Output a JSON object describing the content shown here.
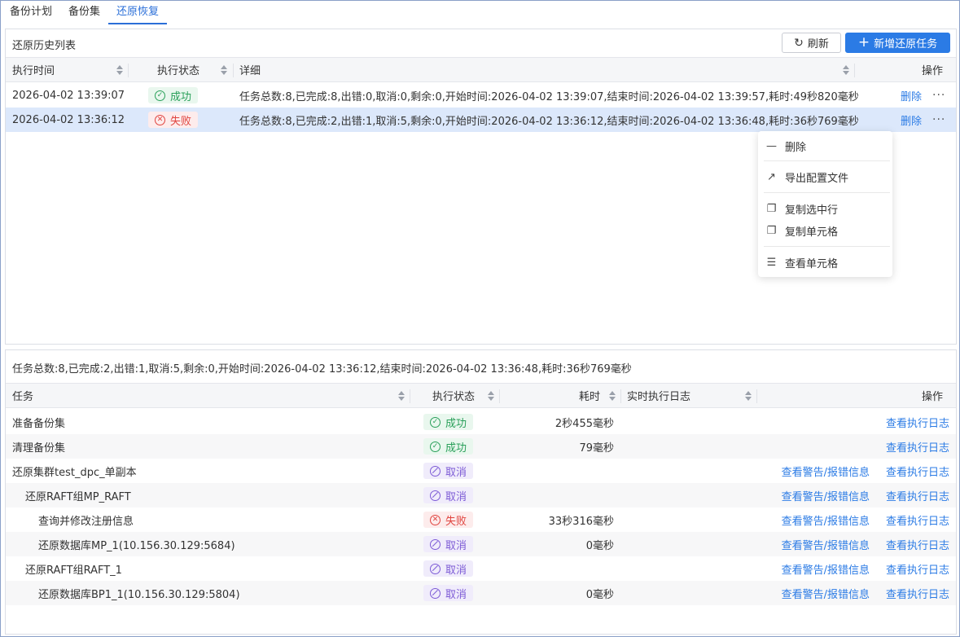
{
  "tabs": [
    "备份计划",
    "备份集",
    "还原恢复"
  ],
  "history": {
    "title": "还原历史列表",
    "refresh_label": "刷新",
    "new_label": "新增还原任务",
    "columns": [
      "执行时间",
      "执行状态",
      "详细",
      "操作"
    ],
    "rows": [
      {
        "time": "2026-04-02 13:39:07",
        "status": "成功",
        "detail": "任务总数:8,已完成:8,出错:0,取消:0,剩余:0,开始时间:2026-04-02 13:39:07,结束时间:2026-04-02 13:39:57,耗时:49秒820毫秒",
        "action": "删除",
        "more": "···"
      },
      {
        "time": "2026-04-02 13:36:12",
        "status": "失败",
        "detail": "任务总数:8,已完成:2,出错:1,取消:5,剩余:0,开始时间:2026-04-02 13:36:12,结束时间:2026-04-02 13:36:48,耗时:36秒769毫秒",
        "action": "删除",
        "more": "···"
      }
    ]
  },
  "context_menu": {
    "items": [
      {
        "label": "删除",
        "icon": "minus-icon"
      },
      {
        "label": "导出配置文件",
        "icon": "export-icon"
      },
      {
        "label": "复制选中行",
        "icon": "copy-icon"
      },
      {
        "label": "复制单元格",
        "icon": "copy-icon"
      },
      {
        "label": "查看单元格",
        "icon": "document-icon"
      }
    ]
  },
  "detail": {
    "summary": "任务总数:8,已完成:2,出错:1,取消:5,剩余:0,开始时间:2026-04-02 13:36:12,结束时间:2026-04-02 13:36:48,耗时:36秒769毫秒",
    "columns": [
      "任务",
      "执行状态",
      "耗时",
      "实时执行日志",
      "操作"
    ],
    "rows": [
      {
        "task": "准备备份集",
        "status": "成功",
        "duration": "2秒455毫秒",
        "warn": "",
        "log": "查看执行日志",
        "level": 0
      },
      {
        "task": "清理备份集",
        "status": "成功",
        "duration": "79毫秒",
        "warn": "",
        "log": "查看执行日志",
        "level": 0
      },
      {
        "task": "还原集群test_dpc_单副本",
        "status": "取消",
        "duration": "",
        "warn": "查看警告/报错信息",
        "log": "查看执行日志",
        "level": 0
      },
      {
        "task": "还原RAFT组MP_RAFT",
        "status": "取消",
        "duration": "",
        "warn": "查看警告/报错信息",
        "log": "查看执行日志",
        "level": 1
      },
      {
        "task": "查询并修改注册信息",
        "status": "失败",
        "duration": "33秒316毫秒",
        "warn": "查看警告/报错信息",
        "log": "查看执行日志",
        "level": 2
      },
      {
        "task": "还原数据库MP_1(10.156.30.129:5684)",
        "status": "取消",
        "duration": "0毫秒",
        "warn": "查看警告/报错信息",
        "log": "查看执行日志",
        "level": 2
      },
      {
        "task": "还原RAFT组RAFT_1",
        "status": "取消",
        "duration": "",
        "warn": "查看警告/报错信息",
        "log": "查看执行日志",
        "level": 1
      },
      {
        "task": "还原数据库BP1_1(10.156.30.129:5804)",
        "status": "取消",
        "duration": "0毫秒",
        "warn": "查看警告/报错信息",
        "log": "查看执行日志",
        "level": 2
      }
    ]
  },
  "colors": {
    "accent": "#2b7be5",
    "success": "#2aa05a",
    "fail": "#e0443f",
    "cancel": "#7d5bd6",
    "selected_row": "#dce8fb"
  }
}
